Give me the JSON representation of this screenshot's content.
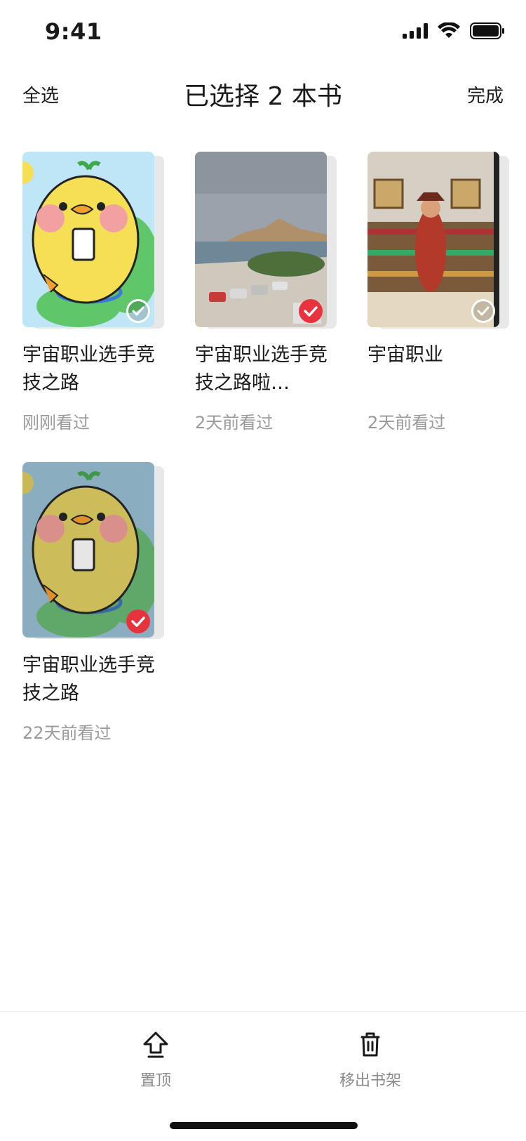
{
  "status_bar": {
    "time": "9:41"
  },
  "nav": {
    "left_label": "全选",
    "title": "已选择 2 本书",
    "right_label": "完成"
  },
  "books": [
    {
      "title": "宇宙职业选手竞技之路",
      "meta": "刚刚看过",
      "selected": false
    },
    {
      "title": "宇宙职业选手竞技之路啦…",
      "meta": "2天前看过",
      "selected": true
    },
    {
      "title": "宇宙职业",
      "meta": "2天前看过",
      "selected": false
    },
    {
      "title": "宇宙职业选手竞技之路",
      "meta": "22天前看过",
      "selected": true
    }
  ],
  "toolbar": {
    "pin_label": "置顶",
    "remove_label": "移出书架"
  },
  "colors": {
    "accent": "#e8333f",
    "muted_text": "#9a9a9a"
  }
}
